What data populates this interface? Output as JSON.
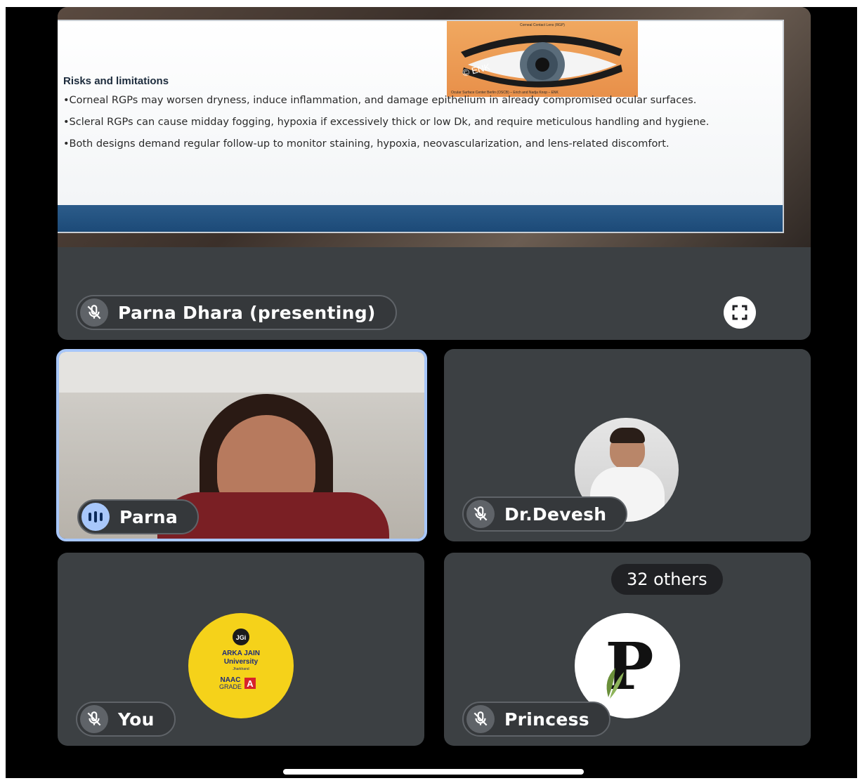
{
  "presenter_tile": {
    "name_label": "Parna Dhara (presenting)",
    "slide": {
      "heading": "Risks and limitations",
      "bullets": [
        "•Corneal RGPs may worsen dryness, induce inflammation, and damage epithelium in already compromised ocular surfaces.",
        "•Scleral RGPs can cause midday fogging, hypoxia if excessively thick or low Dk, and require meticulous handling and hygiene.",
        "•Both designs demand regular follow-up to monitor staining, hypoxia, neovascularization, and lens-related discomfort."
      ],
      "image_caption": "Corneal Contact Lens (RGP)",
      "image_footer": "Ocular Surface Center Berlin (OSCB) – Erich and Nadja Knop – ENK",
      "image_watermark": "© ENK"
    }
  },
  "participants": [
    {
      "name": "Parna",
      "mic": "speaking"
    },
    {
      "name": "Dr.Devesh",
      "mic": "muted"
    },
    {
      "name": "You",
      "mic": "muted",
      "avatar_text": [
        "JGi",
        "ARKA JAIN",
        "University",
        "Jharkhand",
        "NAAC",
        "GRADE",
        "A"
      ]
    },
    {
      "name": "Princess",
      "mic": "muted",
      "avatar_letter": "P"
    }
  ],
  "others_badge": "32 others",
  "icons": {
    "mic_off": "mic-off-icon",
    "speaking": "audio-level-icon",
    "fullscreen": "fullscreen-icon"
  },
  "colors": {
    "tile_bg": "#3c4043",
    "active_border": "#a8c7fa",
    "slide_band": "#2c5c8a",
    "jain_yellow": "#f5d21a"
  }
}
